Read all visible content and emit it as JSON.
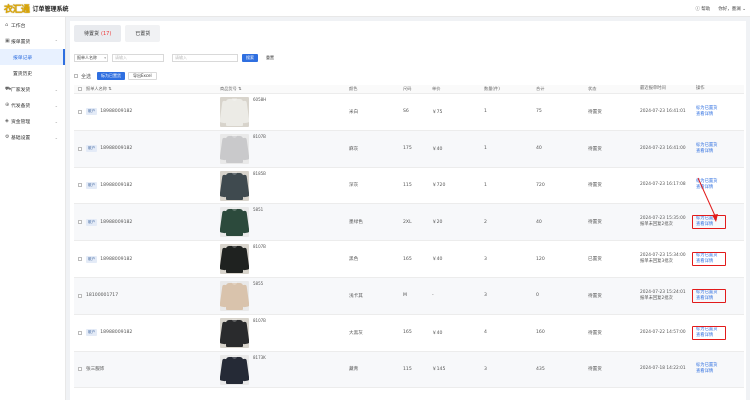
{
  "app": {
    "logo_text": "衣汇通",
    "title": "订单管理系统"
  },
  "topbar": {
    "help": "帮助",
    "user": "你好，墨澜"
  },
  "sidebar": {
    "items": [
      {
        "label": "工作台",
        "icon": "home-icon"
      },
      {
        "label": "报单置货",
        "icon": "box-icon",
        "expanded": true
      },
      {
        "label": "报单记录",
        "sub": true,
        "active": true
      },
      {
        "label": "置货历史",
        "sub": true
      },
      {
        "label": "厂家发货",
        "icon": "truck-icon"
      },
      {
        "label": "代发备货",
        "icon": "cart-icon"
      },
      {
        "label": "资金管理",
        "icon": "shield-icon"
      },
      {
        "label": "基础设置",
        "icon": "gear-icon"
      }
    ]
  },
  "tabs": [
    {
      "label": "待置货",
      "count": "(17)",
      "active": true
    },
    {
      "label": "已置货",
      "count": ""
    }
  ],
  "filter": {
    "field_select": "报单人名称",
    "input1_placeholder": "请输入",
    "input2_placeholder": "请输入",
    "search_label": "搜索",
    "reset_label": "重置"
  },
  "actions": {
    "select_all": "全选",
    "mark_done": "标为已置货",
    "export": "导出Excel"
  },
  "columns": [
    "报单人名称 ⇅",
    "商品货号 ⇅",
    "颜色",
    "尺码",
    "单价",
    "数量(件)",
    "合计",
    "状态",
    "最近报单时间",
    "操作"
  ],
  "rows": [
    {
      "user": "18988009182",
      "tag": "散户",
      "style": "6058H",
      "color": "米白",
      "size": "S6",
      "price": "￥75",
      "qty": "1",
      "total": "75",
      "status": "待置货",
      "time": "2024-07-23 16:41:01",
      "note": "",
      "shirt": "#ecebe6",
      "alt": false,
      "hl": false
    },
    {
      "user": "18988009182",
      "tag": "散户",
      "style": "8107B",
      "color": "麻灰",
      "size": "175",
      "price": "￥40",
      "qty": "1",
      "total": "40",
      "status": "待置货",
      "time": "2024-07-23 16:41:00",
      "note": "",
      "shirt": "#c9c9cb",
      "alt": true,
      "hl": false
    },
    {
      "user": "18988009182",
      "tag": "散户",
      "style": "8185B",
      "color": "深灰",
      "size": "115",
      "price": "￥720",
      "qty": "1",
      "total": "720",
      "status": "待置货",
      "time": "2024-07-23 16:17:08",
      "note": "",
      "shirt": "#3f4a4f",
      "alt": false,
      "hl": false
    },
    {
      "user": "18988009182",
      "tag": "散户",
      "style": "5851",
      "color": "墨绿色",
      "size": "2XL",
      "price": "￥20",
      "qty": "2",
      "total": "40",
      "status": "待置货",
      "time": "2024-07-23 15:35:00",
      "note": "报单未回复2批次",
      "shirt": "#2c4a3c",
      "alt": true,
      "hl": true
    },
    {
      "user": "18988009182",
      "tag": "散户",
      "style": "8107B",
      "color": "黑色",
      "size": "165",
      "price": "￥40",
      "qty": "3",
      "total": "120",
      "status": "已置货",
      "time": "2024-07-23 15:34:00",
      "note": "报单未回复3批次",
      "shirt": "#1f2220",
      "alt": false,
      "hl": true
    },
    {
      "user": "18100001717",
      "tag": "",
      "style": "5855",
      "color": "浅卡其",
      "size": "M",
      "price": "-",
      "qty": "3",
      "total": "0",
      "status": "待置货",
      "time": "2024-07-23 15:24:01",
      "note": "报单未回复2批次",
      "shirt": "#d9c3ac",
      "alt": true,
      "hl": true
    },
    {
      "user": "18988009182",
      "tag": "散户",
      "style": "8107B",
      "color": "大黑灰",
      "size": "165",
      "price": "￥40",
      "qty": "4",
      "total": "160",
      "status": "待置货",
      "time": "2024-07-22 14:57:00",
      "note": "",
      "shirt": "#2a2b2d",
      "alt": false,
      "hl": true
    },
    {
      "user": "张三服饰",
      "tag": "",
      "style": "8173K",
      "color": "藏青",
      "size": "115",
      "price": "￥145",
      "qty": "3",
      "total": "435",
      "status": "待置货",
      "time": "2024-07-18 14:22:01",
      "note": "",
      "shirt": "#252a36",
      "alt": true,
      "hl": false
    }
  ],
  "row_actions": {
    "mark": "标为已置货",
    "view": "查看详情"
  },
  "colors": {
    "accent": "#2f6fe0",
    "highlight": "#e21b1b"
  }
}
